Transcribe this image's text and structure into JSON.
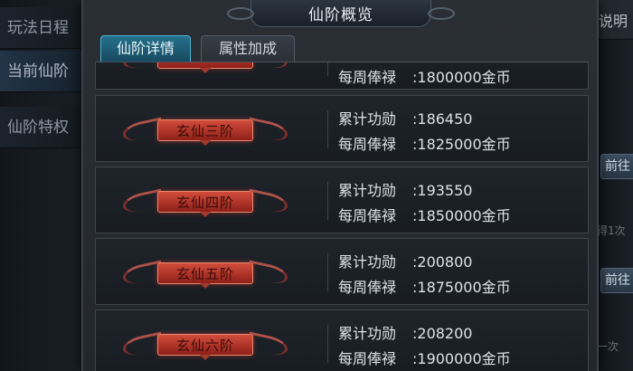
{
  "left_nav": {
    "items": [
      {
        "label": "玩法日程",
        "active": false
      },
      {
        "label": "当前仙阶",
        "active": true
      },
      {
        "label": "仙阶特权",
        "active": false
      }
    ]
  },
  "right_bg": {
    "header": "说明",
    "btn1": "前往",
    "hint1": "得1次",
    "btn2": "前往",
    "hint2": "一次"
  },
  "panel": {
    "title": "仙阶概览",
    "tabs": [
      {
        "label": "仙阶详情",
        "active": true
      },
      {
        "label": "属性加成",
        "active": false
      }
    ]
  },
  "rows": [
    {
      "rank": "",
      "merit_label": "",
      "merit": "",
      "salary_label": "每周俸禄",
      "salary": ":1800000金币"
    },
    {
      "rank": "玄仙三阶",
      "merit_label": "累计功勋",
      "merit": ":186450",
      "salary_label": "每周俸禄",
      "salary": ":1825000金币"
    },
    {
      "rank": "玄仙四阶",
      "merit_label": "累计功勋",
      "merit": ":193550",
      "salary_label": "每周俸禄",
      "salary": ":1850000金币"
    },
    {
      "rank": "玄仙五阶",
      "merit_label": "累计功勋",
      "merit": ":200800",
      "salary_label": "每周俸禄",
      "salary": ":1875000金币"
    },
    {
      "rank": "玄仙六阶",
      "merit_label": "累计功勋",
      "merit": ":208200",
      "salary_label": "每周俸禄",
      "salary": ":1900000金币"
    }
  ],
  "colors": {
    "badge_red": "#d24c3c",
    "tab_active": "#25708c"
  }
}
